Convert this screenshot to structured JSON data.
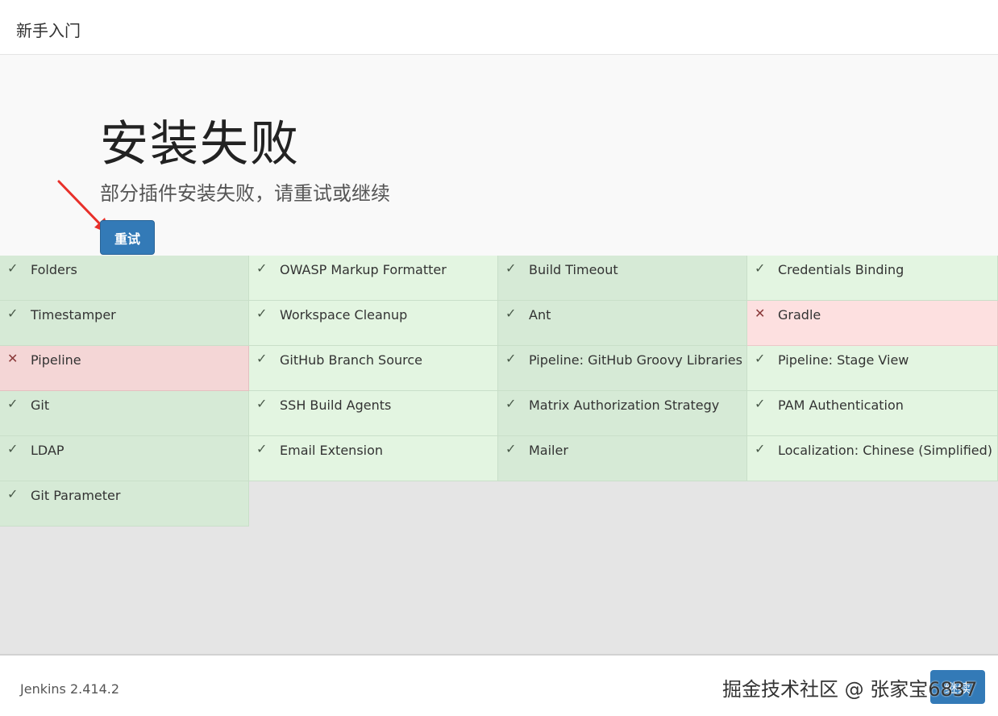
{
  "header": {
    "title": "新手入门"
  },
  "hero": {
    "heading": "安装失败",
    "subtitle": "部分插件安装失败，请重试或继续",
    "retry_label": "重试"
  },
  "colors": {
    "accent": "#337ab7",
    "success_bg": "#d6ead6",
    "fail_bg": "#f4d6d6"
  },
  "plugins": [
    {
      "name": "Folders",
      "status": "success",
      "icon": "check-icon"
    },
    {
      "name": "OWASP Markup Formatter",
      "status": "success",
      "icon": "check-icon"
    },
    {
      "name": "Build Timeout",
      "status": "success",
      "icon": "check-icon"
    },
    {
      "name": "Credentials Binding",
      "status": "success",
      "icon": "check-icon"
    },
    {
      "name": "Timestamper",
      "status": "success",
      "icon": "check-icon"
    },
    {
      "name": "Workspace Cleanup",
      "status": "success",
      "icon": "check-icon"
    },
    {
      "name": "Ant",
      "status": "success",
      "icon": "check-icon"
    },
    {
      "name": "Gradle",
      "status": "failed",
      "icon": "cross-icon"
    },
    {
      "name": "Pipeline",
      "status": "failed",
      "icon": "cross-icon"
    },
    {
      "name": "GitHub Branch Source",
      "status": "success",
      "icon": "check-icon"
    },
    {
      "name": "Pipeline: GitHub Groovy Libraries",
      "status": "success",
      "icon": "check-icon"
    },
    {
      "name": "Pipeline: Stage View",
      "status": "success",
      "icon": "check-icon"
    },
    {
      "name": "Git",
      "status": "success",
      "icon": "check-icon"
    },
    {
      "name": "SSH Build Agents",
      "status": "success",
      "icon": "check-icon"
    },
    {
      "name": "Matrix Authorization Strategy",
      "status": "success",
      "icon": "check-icon"
    },
    {
      "name": "PAM Authentication",
      "status": "success",
      "icon": "check-icon"
    },
    {
      "name": "LDAP",
      "status": "success",
      "icon": "check-icon"
    },
    {
      "name": "Email Extension",
      "status": "success",
      "icon": "check-icon"
    },
    {
      "name": "Mailer",
      "status": "success",
      "icon": "check-icon"
    },
    {
      "name": "Localization: Chinese (Simplified)",
      "status": "success",
      "icon": "check-icon"
    },
    {
      "name": "Git Parameter",
      "status": "success",
      "icon": "check-icon"
    }
  ],
  "footer": {
    "version": "Jenkins 2.414.2",
    "continue_label": "继续",
    "watermark": "掘金技术社区 @ 张家宝6837"
  }
}
